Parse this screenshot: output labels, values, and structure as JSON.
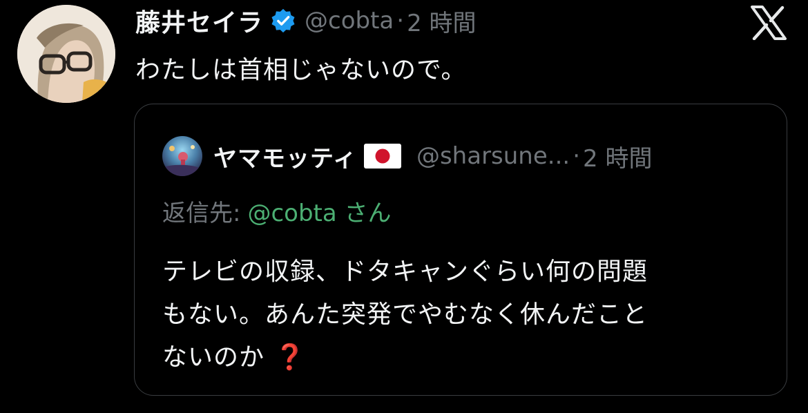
{
  "tweet": {
    "author": {
      "display_name": "藤井セイラ",
      "handle": "@cobta",
      "verified": true,
      "avatar_icon": "user-avatar"
    },
    "separator": "·",
    "time": "2 時間",
    "text": "わたしは首相じゃないので。",
    "brand_icon": "x-logo-icon"
  },
  "quote": {
    "author": {
      "display_name": "ヤマモッティ",
      "flag_icon": "japan-flag-icon",
      "handle": "@sharsune...",
      "avatar_icon": "user-avatar"
    },
    "separator": "·",
    "time": "2 時間",
    "reply_label": "返信先:",
    "reply_handle": "@cobta さん",
    "body_lines": [
      "テレビの収録、ドタキャンぐらい何の問題",
      "もない。あんた突発でやむなく休んだこと",
      "ないのか"
    ],
    "end_emoji": "❓"
  },
  "colors": {
    "background": "#000000",
    "text_primary": "#f2f4f5",
    "text_secondary": "#71767b",
    "verified_blue": "#1d9bf0",
    "mention_green": "#4caf73",
    "card_border": "#3a3d41",
    "emoji_red": "#d62a2a"
  }
}
